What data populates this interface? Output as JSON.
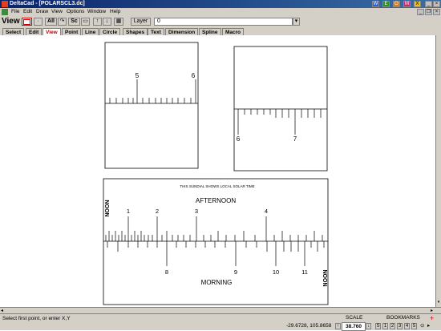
{
  "window": {
    "title": "DeltaCad - [POLARSCL3.dc]"
  },
  "titlebar_icons": [
    "app-icon-w",
    "app-icon-e",
    "app-icon-o",
    "app-icon-m",
    "app-icon-x"
  ],
  "menu": [
    "File",
    "Edit",
    "Draw",
    "View",
    "Options",
    "Window",
    "Help"
  ],
  "toolbar": {
    "mode_label": "View",
    "all_label": "All",
    "sc_label": "Sc",
    "layer_label": "Layer",
    "layer_value": "0"
  },
  "tabs": [
    "Select",
    "Edit",
    "View",
    "Point",
    "Line",
    "Circle",
    "Shapes",
    "Text",
    "Dimension",
    "Spline",
    "Macro"
  ],
  "active_tab": "View",
  "drawing": {
    "box1_labels": [
      "5",
      "6"
    ],
    "box2_labels": [
      "6",
      "7"
    ],
    "dial_caption": "THIS SUNDIAL SHOWS LOCAL SOLAR TIME",
    "afternoon_label": "AFTERNOON",
    "morning_label": "MORNING",
    "noon_label": "NOON",
    "afternoon_hours": [
      "1",
      "2",
      "3",
      "4"
    ],
    "morning_hours": [
      "8",
      "9",
      "10",
      "11"
    ]
  },
  "status": {
    "prompt": "Select first point, or enter X,Y",
    "scale_label": "SCALE",
    "coords": "-29.6728, 105.8658",
    "scale_value": "38.760",
    "bookmarks_label": "BOOKMARKS",
    "bookmarks": [
      "S",
      "1",
      "2",
      "3",
      "4",
      "5"
    ]
  },
  "colors": {
    "titlebar": "#0a246a",
    "active_tab_text": "#c00000",
    "chrome": "#d4d0c8"
  }
}
